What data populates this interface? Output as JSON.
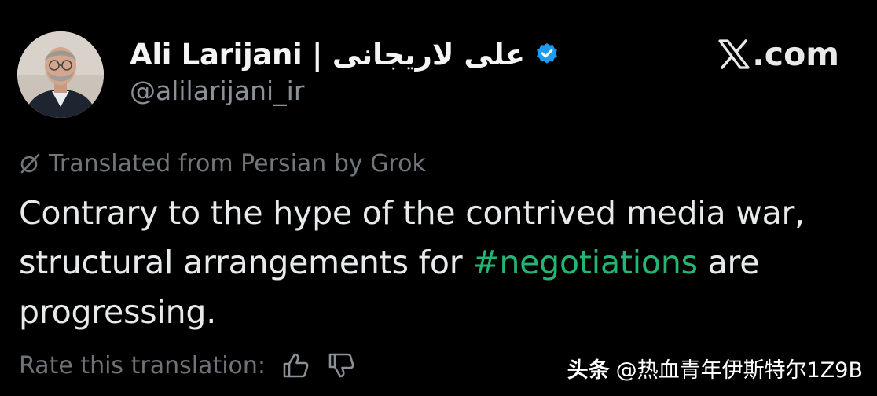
{
  "author": {
    "name_latin": "Ali Larijani",
    "separator": "|",
    "name_persian": "علی لاریجانی",
    "handle": "@alilarijani_ir",
    "avatar_icon": "person-portrait",
    "verified_icon": "verified-badge-icon",
    "verified_color": "#1d9bf0"
  },
  "brand": {
    "label": ".com",
    "logo_icon": "x-logo-icon"
  },
  "translation": {
    "notice": "Translated from Persian by Grok",
    "icon": "grok-icon"
  },
  "tweet": {
    "text_before": "Contrary to the hype of the contrived media war, structural arrangements for ",
    "hashtag": "#negotiations",
    "text_after": " are progressing.",
    "hashtag_color": "#22b573"
  },
  "rating": {
    "prompt": "Rate this translation:",
    "thumbs_up_icon": "thumbs-up-icon",
    "thumbs_down_icon": "thumbs-down-icon"
  },
  "watermark": {
    "brand": "头条",
    "handle": "@热血青年伊斯特尔1Z9B"
  }
}
